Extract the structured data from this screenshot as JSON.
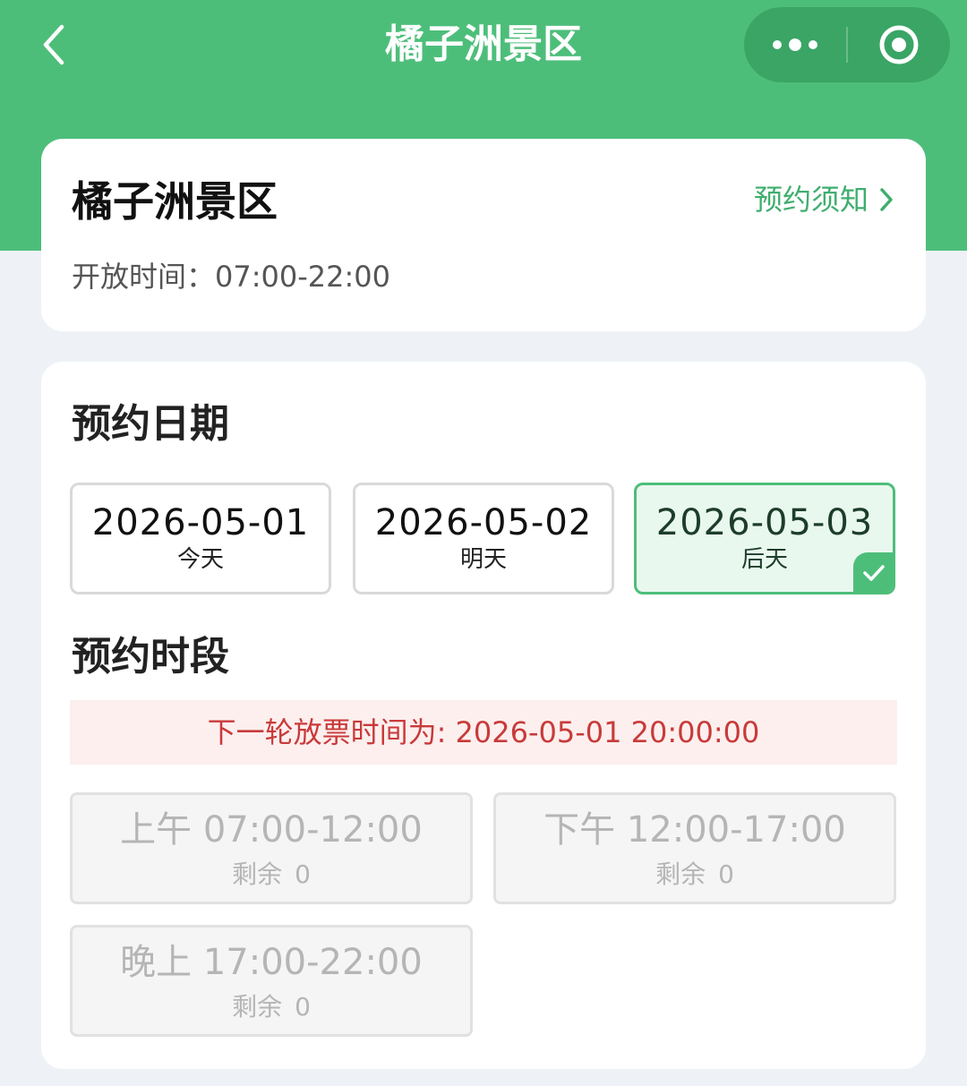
{
  "navbar": {
    "title": "橘子洲景区"
  },
  "info": {
    "title": "橘子洲景区",
    "notice_label": "预约须知",
    "open_time": "开放时间：07:00-22:00"
  },
  "booking": {
    "date_title": "预约日期",
    "dates": [
      {
        "date": "2026-05-01",
        "label": "今天"
      },
      {
        "date": "2026-05-02",
        "label": "明天"
      },
      {
        "date": "2026-05-03",
        "label": "后天"
      }
    ],
    "selected_date": "2026-05-03",
    "slot_title": "预约时段",
    "release_notice": "下一轮放票时间为: 2026-05-01 20:00:00",
    "remaining_label": "剩余",
    "slots": [
      {
        "time": "上午 07:00-12:00",
        "remaining": "0"
      },
      {
        "time": "下午 12:00-17:00",
        "remaining": "0"
      },
      {
        "time": "晚上 17:00-22:00",
        "remaining": "0"
      }
    ]
  },
  "colors": {
    "brand_green": "#4dbe7a",
    "notice_red": "#c93a3a"
  }
}
